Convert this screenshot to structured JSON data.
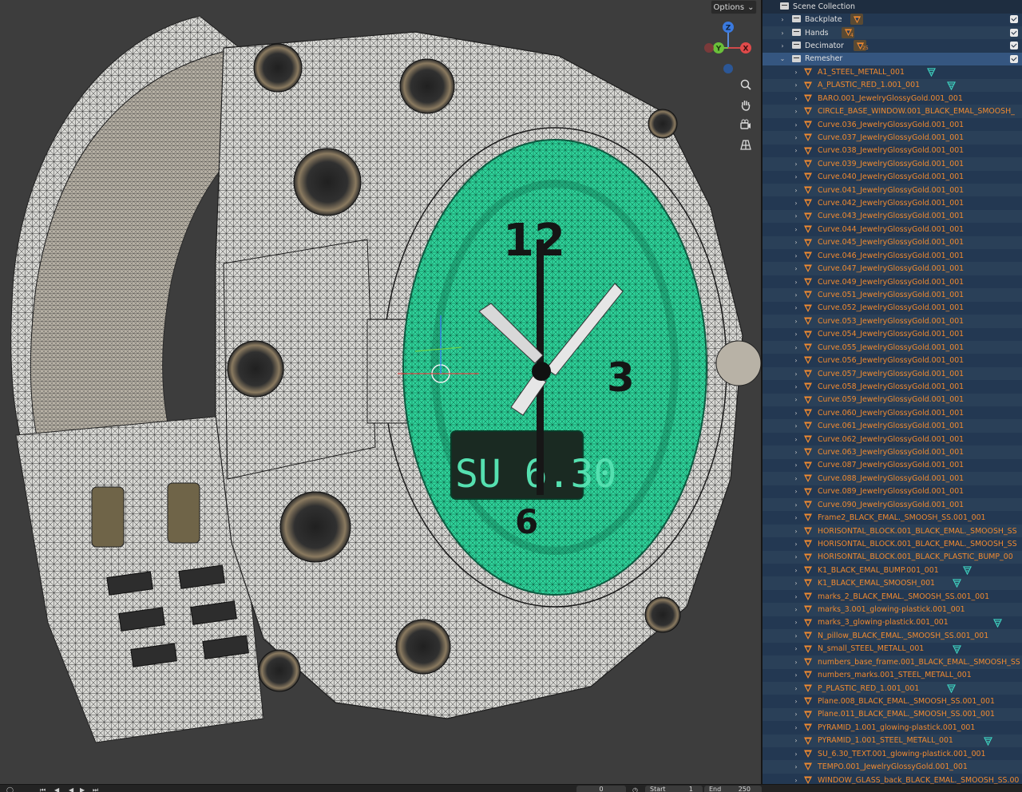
{
  "viewport": {
    "options_label": "Options",
    "gizmo_axes": [
      "Z",
      "Y",
      "X"
    ],
    "watch_lcd_text": "SU 6.30",
    "dial_numerals": [
      "12",
      "3",
      "6"
    ]
  },
  "timeline": {
    "frame": "0",
    "start_label": "Start",
    "start_value": "1",
    "end_label": "End",
    "end_value": "250"
  },
  "outliner": {
    "root_label": "Scene Collection",
    "collections": [
      {
        "label": "Backplate",
        "badge": "decimate-icon"
      },
      {
        "label": "Hands",
        "badge_count": "4"
      },
      {
        "label": "Decimator",
        "badge_count": "25"
      },
      {
        "label": "Remesher",
        "selected": true
      }
    ],
    "objects": [
      "A1_STEEL_METALL_001",
      "A_PLASTIC_RED_1.001_001",
      "BARO.001_JewelryGlossyGold.001_001",
      "CIRCLE_BASE_WINDOW.001_BLACK_EMAL_SMOOSH_",
      "Curve.036_JewelryGlossyGold.001_001",
      "Curve.037_JewelryGlossyGold.001_001",
      "Curve.038_JewelryGlossyGold.001_001",
      "Curve.039_JewelryGlossyGold.001_001",
      "Curve.040_JewelryGlossyGold.001_001",
      "Curve.041_JewelryGlossyGold.001_001",
      "Curve.042_JewelryGlossyGold.001_001",
      "Curve.043_JewelryGlossyGold.001_001",
      "Curve.044_JewelryGlossyGold.001_001",
      "Curve.045_JewelryGlossyGold.001_001",
      "Curve.046_JewelryGlossyGold.001_001",
      "Curve.047_JewelryGlossyGold.001_001",
      "Curve.049_JewelryGlossyGold.001_001",
      "Curve.051_JewelryGlossyGold.001_001",
      "Curve.052_JewelryGlossyGold.001_001",
      "Curve.053_JewelryGlossyGold.001_001",
      "Curve.054_JewelryGlossyGold.001_001",
      "Curve.055_JewelryGlossyGold.001_001",
      "Curve.056_JewelryGlossyGold.001_001",
      "Curve.057_JewelryGlossyGold.001_001",
      "Curve.058_JewelryGlossyGold.001_001",
      "Curve.059_JewelryGlossyGold.001_001",
      "Curve.060_JewelryGlossyGold.001_001",
      "Curve.061_JewelryGlossyGold.001_001",
      "Curve.062_JewelryGlossyGold.001_001",
      "Curve.063_JewelryGlossyGold.001_001",
      "Curve.087_JewelryGlossyGold.001_001",
      "Curve.088_JewelryGlossyGold.001_001",
      "Curve.089_JewelryGlossyGold.001_001",
      "Curve.090_JewelryGlossyGold.001_001",
      "Frame2_BLACK_EMAL._SMOOSH_SS.001_001",
      "HORISONTAL_BLOCK.001_BLACK_EMAL._SMOOSH_SS",
      "HORISONTAL_BLOCK.001_BLACK_EMAL._SMOOSH_SS",
      "HORISONTAL_BLOCK.001_BLACK_PLASTIC_BUMP_00",
      "K1_BLACK_EMAL_BUMP.001_001",
      "K1_BLACK_EMAL_SMOOSH_001",
      "marks_2_BLACK_EMAL._SMOOSH_SS.001_001",
      "marks_3.001_glowing-plastick.001_001",
      "marks_3_glowing-plastick.001_001",
      "N_pillow_BLACK_EMAL._SMOOSH_SS.001_001",
      "N_small_STEEL_METALL_001",
      "numbers_base_frame.001_BLACK_EMAL._SMOOSH_SS",
      "numbers_marks.001_STEEL_METALL_001",
      "P_PLASTIC_RED_1.001_001",
      "Plane.008_BLACK_EMAL._SMOOSH_SS.001_001",
      "Plane.011_BLACK_EMAL._SMOOSH_SS.001_001",
      "PYRAMID_1.001_glowing-plastick.001_001",
      "PYRAMID_1.001_STEEL_METALL_001",
      "SU_6.30_TEXT.001_glowing-plastick.001_001",
      "TEMPO.001_JewelryGlossyGold.001_001",
      "WINDOW_GLASS_back_BLACK_EMAL._SMOOSH_SS.00"
    ],
    "colors": {
      "object_text": "#f08a30",
      "modifier_icon": "#3fd4c2",
      "panel_bg": "#233852",
      "selected_bg": "#355680"
    }
  }
}
